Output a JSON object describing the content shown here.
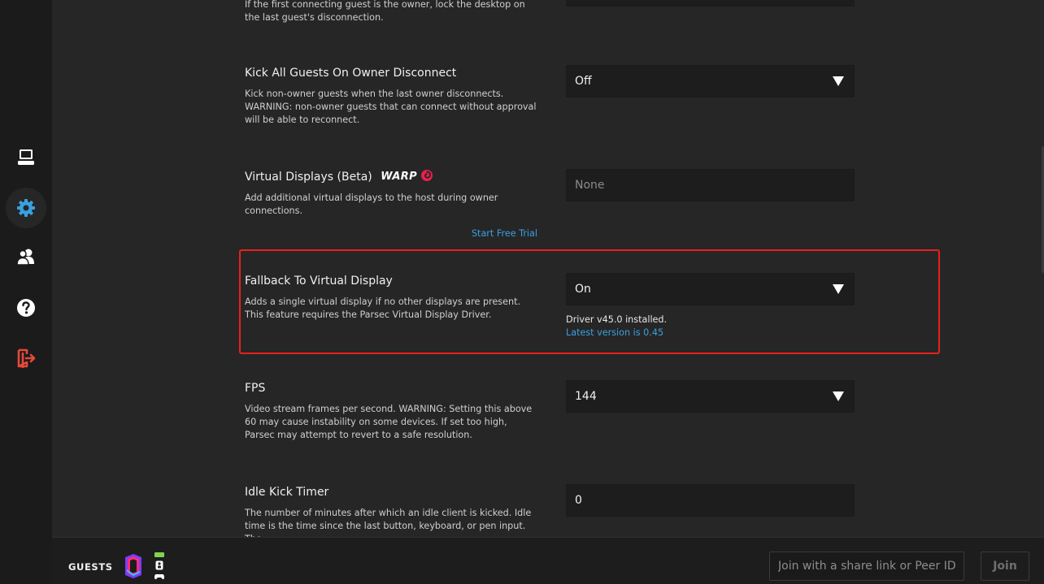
{
  "nav": {
    "items": [
      {
        "icon": "computer-icon"
      },
      {
        "icon": "gear-icon",
        "active": true
      },
      {
        "icon": "friends-icon"
      },
      {
        "icon": "help-icon"
      },
      {
        "icon": "logout-icon"
      }
    ],
    "accent_color": "#3aa0e0",
    "logout_color": "#e8483a"
  },
  "settings": {
    "lock_desktop": {
      "desc": "If the first connecting guest is the owner, lock the desktop on the last guest's disconnection."
    },
    "kick_all": {
      "title": "Kick All Guests On Owner Disconnect",
      "desc": "Kick non-owner guests when the last owner disconnects. WARNING: non-owner guests that can connect without approval will be able to reconnect.",
      "value": "Off"
    },
    "virtual_displays": {
      "title": "Virtual Displays (Beta)",
      "badge": "WARP",
      "desc": "Add additional virtual displays to the host during owner connections.",
      "trial_link": "Start Free Trial",
      "placeholder": "None"
    },
    "fallback": {
      "title": "Fallback To Virtual Display",
      "desc": "Adds a single virtual display if no other displays are present. This feature requires the Parsec Virtual Display Driver.",
      "value": "On",
      "driver_status": "Driver v45.0 installed.",
      "latest_version": "Latest version is 0.45"
    },
    "fps": {
      "title": "FPS",
      "desc": "Video stream frames per second. WARNING: Setting this above 60 may cause instability on some devices. If set too high, Parsec may attempt to revert to a safe resolution.",
      "value": "144"
    },
    "idle_kick": {
      "title": "Idle Kick Timer",
      "desc": "The number of minutes after which an idle client is kicked. Idle time is the time since the last button, keyboard, or pen input. The",
      "value": "0"
    }
  },
  "footer": {
    "guests_label": "GUESTS",
    "join_placeholder": "Join with a share link or Peer ID.",
    "join_label": "Join"
  }
}
